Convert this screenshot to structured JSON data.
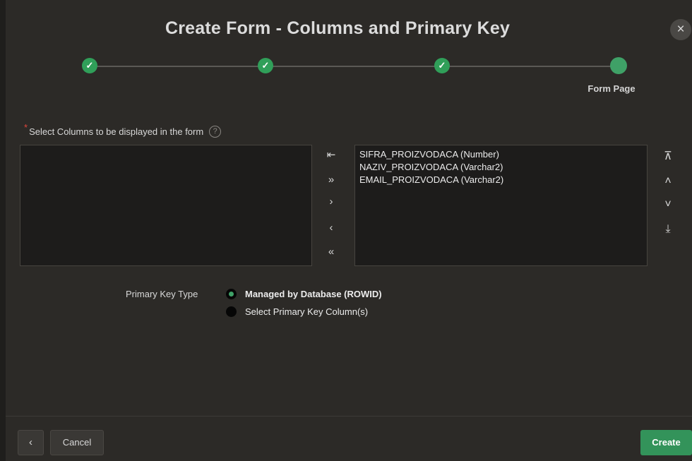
{
  "dialog": {
    "title": "Create Form - Columns and Primary Key",
    "close_icon": "×"
  },
  "train": {
    "steps": [
      {
        "state": "complete",
        "icon": "✓"
      },
      {
        "state": "complete",
        "icon": "✓"
      },
      {
        "state": "complete",
        "icon": "✓"
      },
      {
        "state": "current",
        "icon": ""
      }
    ],
    "current_label": "Form Page",
    "accent_color": "#309f59"
  },
  "columns": {
    "required_marker": "*",
    "label": "Select Columns to be displayed in the form",
    "help_icon": "?",
    "available": [],
    "selected": [
      "SIFRA_PROIZVODACA (Number)",
      "NAZIV_PROIZVODACA (Varchar2)",
      "EMAIL_PROIZVODACA (Varchar2)"
    ]
  },
  "shuttle": {
    "reset_icon": "⇤",
    "move_all": "»",
    "move": "›",
    "remove": "‹",
    "remove_all": "«"
  },
  "ordering": {
    "top": "⊼",
    "up": "˄",
    "down": "˅",
    "bottom": "⤓"
  },
  "primary_key": {
    "label": "Primary Key Type",
    "options": [
      {
        "label": "Managed by Database (ROWID)",
        "selected": true
      },
      {
        "label": "Select Primary Key Column(s)",
        "selected": false
      }
    ]
  },
  "footer": {
    "back_icon": "‹",
    "cancel_label": "Cancel",
    "create_label": "Create"
  }
}
